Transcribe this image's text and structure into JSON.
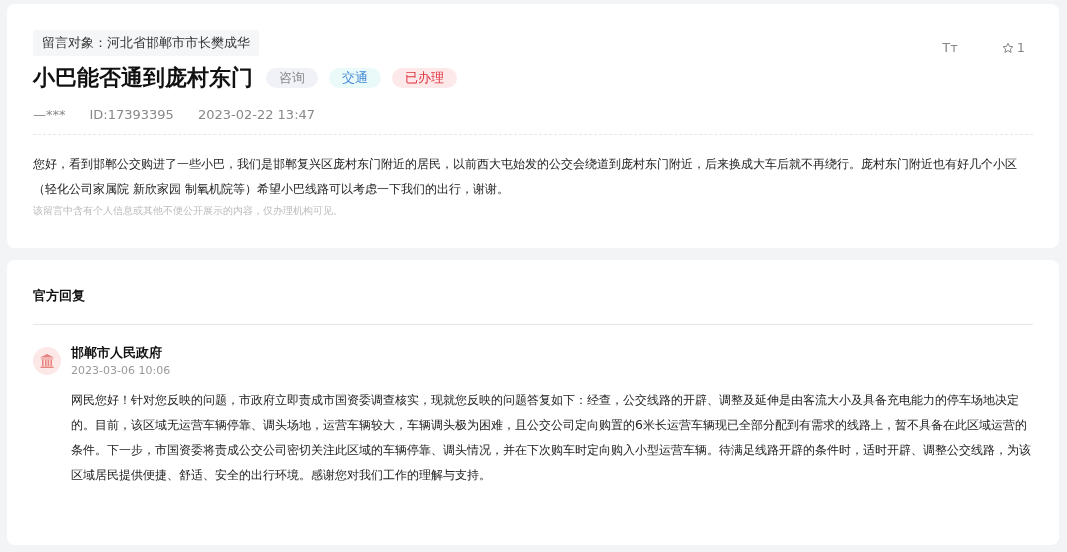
{
  "message": {
    "recipient": "留言对象：河北省邯郸市市长樊成华",
    "title": "小巴能否通到庞村东门",
    "tags": [
      {
        "label": "咨询",
        "kind": "type"
      },
      {
        "label": "交通",
        "kind": "topic"
      },
      {
        "label": "已办理",
        "kind": "status"
      }
    ],
    "font_size_icon": "Tт",
    "stars": "1",
    "author": "—***",
    "id": "ID:17393395",
    "time": "2023-02-22 13:47",
    "body": "您好，看到邯郸公交购进了一些小巴，我们是邯郸复兴区庞村东门附近的居民，以前西大屯始发的公交会绕道到庞村东门附近，后来换成大车后就不再绕行。庞村东门附近也有好几个小区（轻化公司家属院 新欣家园 制氧机院等）希望小巴线路可以考虑一下我们的出行，谢谢。",
    "notice": "该留言中含有个人信息或其他不便公开展示的内容，仅办理机构可见。"
  },
  "reply": {
    "heading": "官方回复",
    "org": "邯郸市人民政府",
    "time": "2023-03-06 10:06",
    "body": "网民您好！针对您反映的问题，市政府立即责成市国资委调查核实，现就您反映的问题答复如下：经查，公交线路的开辟、调整及延伸是由客流大小及具备充电能力的停车场地决定的。目前，该区域无运营车辆停靠、调头场地，运营车辆较大，车辆调头极为困难，且公交公司定向购置的6米长运营车辆现已全部分配到有需求的线路上，暂不具备在此区域运营的条件。下一步，市国资委将责成公交公司密切关注此区域的车辆停靠、调头情况，并在下次购车时定向购入小型运营车辆。待满足线路开辟的条件时，适时开辟、调整公交线路，为该区域居民提供便捷、舒适、安全的出行环境。感谢您对我们工作的理解与支持。"
  }
}
